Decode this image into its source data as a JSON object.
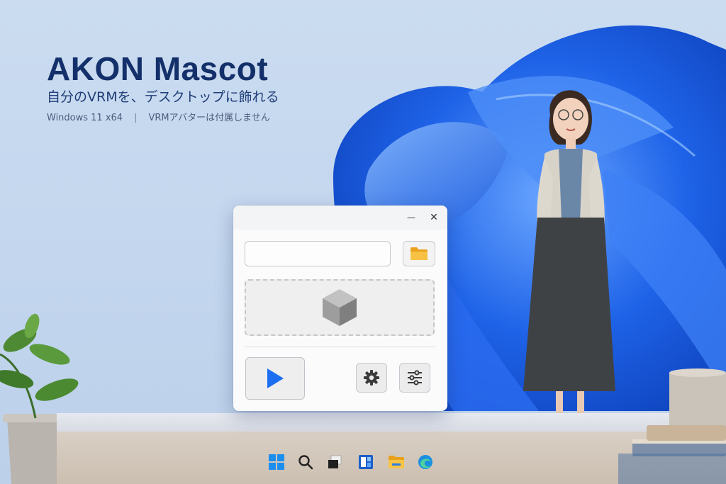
{
  "hero": {
    "title": "AKON Mascot",
    "subtitle": "自分のVRMを、デスクトップに飾れる",
    "platform": "Windows 11 x64",
    "separator": "|",
    "note": "VRMアバターは付属しません"
  },
  "window": {
    "minimize_glyph": "—",
    "close_glyph": "✕",
    "path_input": {
      "value": "",
      "placeholder": ""
    },
    "icons": {
      "folder": "folder-icon",
      "drop_zone": "cube-icon",
      "play": "play-icon",
      "settings": "gear-icon",
      "adjust": "sliders-icon"
    }
  },
  "taskbar": {
    "icons": [
      "windows-start-icon",
      "search-icon",
      "task-view-icon",
      "widgets-icon",
      "file-explorer-icon",
      "edge-browser-icon"
    ]
  },
  "colors": {
    "accent": "#1d6ff2",
    "title_text": "#14306a",
    "folder": "#f5b82e",
    "wallpaper_bloom": "#1f63e8"
  }
}
